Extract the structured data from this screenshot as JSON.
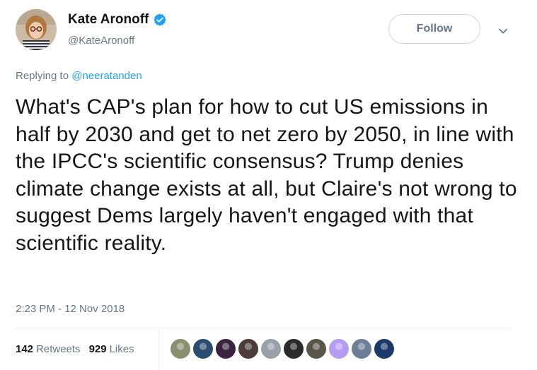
{
  "author": {
    "display_name": "Kate Aronoff",
    "handle": "@KateAronoff",
    "verified_icon": "verified-badge-icon"
  },
  "actions": {
    "follow_label": "Follow",
    "menu_icon": "chevron-down-icon"
  },
  "reply": {
    "prefix": "Replying to ",
    "to_handle": "@neeratanden"
  },
  "tweet": {
    "text": "What's CAP's plan for how to cut US emissions in half by 2030 and get to net zero by 2050, in line with the IPCC's scientific consensus? Trump denies climate change exists at all, but Claire's not wrong to suggest Dems largely haven't engaged with that scientific reality.",
    "timestamp": "2:23 PM - 12 Nov 2018"
  },
  "stats": {
    "retweets_count": "142",
    "retweets_label": "Retweets",
    "likes_count": "929",
    "likes_label": "Likes"
  },
  "likers": [
    {
      "color": "#8a8f6f"
    },
    {
      "color": "#2c4e6e"
    },
    {
      "color": "#3a2440"
    },
    {
      "color": "#4b3b3b"
    },
    {
      "color": "#9aa0a8"
    },
    {
      "color": "#2b2b2b"
    },
    {
      "color": "#5a5548"
    },
    {
      "color": "#b59cf0"
    },
    {
      "color": "#6c7f96"
    },
    {
      "color": "#1b3a6a"
    }
  ],
  "colors": {
    "link": "#1da1f2",
    "muted": "#657786",
    "text": "#14171a"
  }
}
